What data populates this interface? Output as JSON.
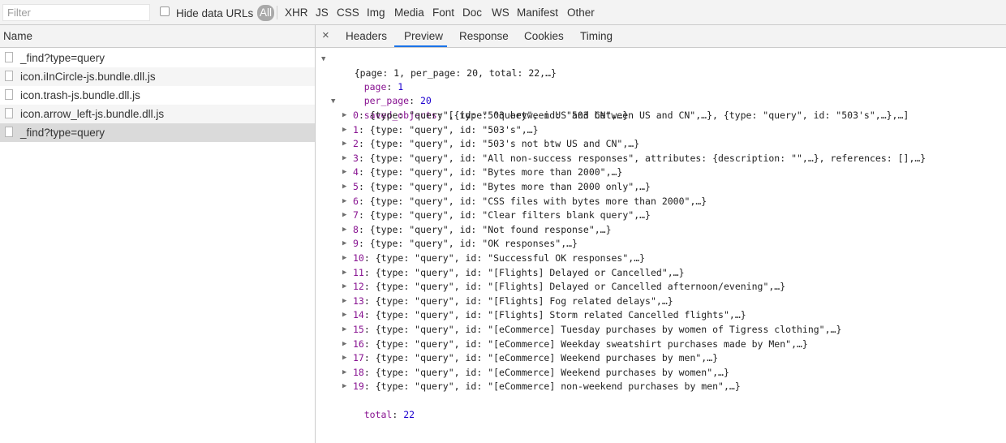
{
  "toolbar": {
    "filter_placeholder": "Filter",
    "hide_data_urls_label": "Hide data URLs",
    "types": [
      "All",
      "XHR",
      "JS",
      "CSS",
      "Img",
      "Media",
      "Font",
      "Doc",
      "WS",
      "Manifest",
      "Other"
    ]
  },
  "requests": {
    "header": "Name",
    "items": [
      "_find?type=query",
      "icon.iInCircle-js.bundle.dll.js",
      "icon.trash-js.bundle.dll.js",
      "icon.arrow_left-js.bundle.dll.js",
      "_find?type=query"
    ],
    "selected_index": 4
  },
  "detail": {
    "close_symbol": "×",
    "tabs": [
      "Headers",
      "Preview",
      "Response",
      "Cookies",
      "Timing"
    ],
    "active_tab": "Preview"
  },
  "preview": {
    "summary": "{page: 1, per_page: 20, total: 22,…}",
    "page_key": "page",
    "page_value": "1",
    "per_page_key": "per_page",
    "per_page_value": "20",
    "saved_objects_key": "saved_objects",
    "saved_objects_summary": "[{type: \"query\", id: \"503 between US and CN\",…}, {type: \"query\", id: \"503's\",…},…]",
    "objects": [
      {
        "index": "0",
        "text": "{type: \"query\", id: \"503 between US and CN\",…}"
      },
      {
        "index": "1",
        "text": "{type: \"query\", id: \"503's\",…}"
      },
      {
        "index": "2",
        "text": "{type: \"query\", id: \"503's not btw US and CN\",…}"
      },
      {
        "index": "3",
        "text": "{type: \"query\", id: \"All non-success responses\", attributes: {description: \"\",…}, references: [],…}"
      },
      {
        "index": "4",
        "text": "{type: \"query\", id: \"Bytes more than 2000\",…}"
      },
      {
        "index": "5",
        "text": "{type: \"query\", id: \"Bytes more than 2000 only\",…}"
      },
      {
        "index": "6",
        "text": "{type: \"query\", id: \"CSS files with bytes more than 2000\",…}"
      },
      {
        "index": "7",
        "text": "{type: \"query\", id: \"Clear filters blank query\",…}"
      },
      {
        "index": "8",
        "text": "{type: \"query\", id: \"Not found response\",…}"
      },
      {
        "index": "9",
        "text": "{type: \"query\", id: \"OK responses\",…}"
      },
      {
        "index": "10",
        "text": "{type: \"query\", id: \"Successful OK responses\",…}"
      },
      {
        "index": "11",
        "text": "{type: \"query\", id: \"[Flights] Delayed or Cancelled\",…}"
      },
      {
        "index": "12",
        "text": "{type: \"query\", id: \"[Flights] Delayed or Cancelled afternoon/evening\",…}"
      },
      {
        "index": "13",
        "text": "{type: \"query\", id: \"[Flights] Fog related delays\",…}"
      },
      {
        "index": "14",
        "text": "{type: \"query\", id: \"[Flights] Storm related Cancelled flights\",…}"
      },
      {
        "index": "15",
        "text": "{type: \"query\", id: \"[eCommerce] Tuesday purchases by women of Tigress clothing\",…}"
      },
      {
        "index": "16",
        "text": "{type: \"query\", id: \"[eCommerce] Weekday sweatshirt purchases made by Men\",…}"
      },
      {
        "index": "17",
        "text": "{type: \"query\", id: \"[eCommerce] Weekend purchases by men\",…}"
      },
      {
        "index": "18",
        "text": "{type: \"query\", id: \"[eCommerce] Weekend purchases by women\",…}"
      },
      {
        "index": "19",
        "text": "{type: \"query\", id: \"[eCommerce] non-weekend purchases by men\",…}"
      }
    ],
    "total_key": "total",
    "total_value": "22"
  }
}
